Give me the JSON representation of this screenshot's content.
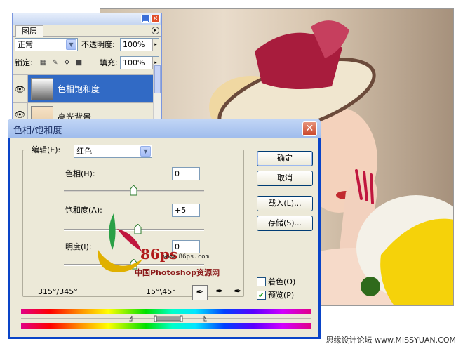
{
  "layers_panel": {
    "tab_label": "图层",
    "blend_mode": "正常",
    "opacity_label": "不透明度:",
    "opacity_value": "100%",
    "lock_label": "锁定:",
    "fill_label": "填充:",
    "fill_value": "100%",
    "layers": [
      {
        "name": "色相饱和度",
        "selected": true
      },
      {
        "name": "高光背景",
        "selected": false
      }
    ]
  },
  "dialog": {
    "title": "色相/饱和度",
    "edit_label": "编辑(E):",
    "edit_value": "红色",
    "hue_label": "色相(H):",
    "hue_value": "0",
    "saturation_label": "饱和度(A):",
    "saturation_value": "+5",
    "lightness_label": "明度(I):",
    "lightness_value": "0",
    "ok_label": "确定",
    "cancel_label": "取消",
    "load_label": "载入(L)...",
    "save_label": "存储(S)...",
    "colorize_label": "着色(O)",
    "colorize_checked": false,
    "preview_label": "预览(P)",
    "preview_checked": true,
    "range_left": "315°/345°",
    "range_right": "15°\\45°"
  },
  "watermark": {
    "number": "86ps",
    "domain": "www.86ps.com",
    "site": "中国Photoshop资源网"
  },
  "footer": {
    "text": "思缘设计论坛 www.MISSYUAN.COM"
  },
  "colors": {
    "selection": "#316ac5",
    "dialog_border": "#0a44c8",
    "dialog_bg": "#ece9d8"
  }
}
